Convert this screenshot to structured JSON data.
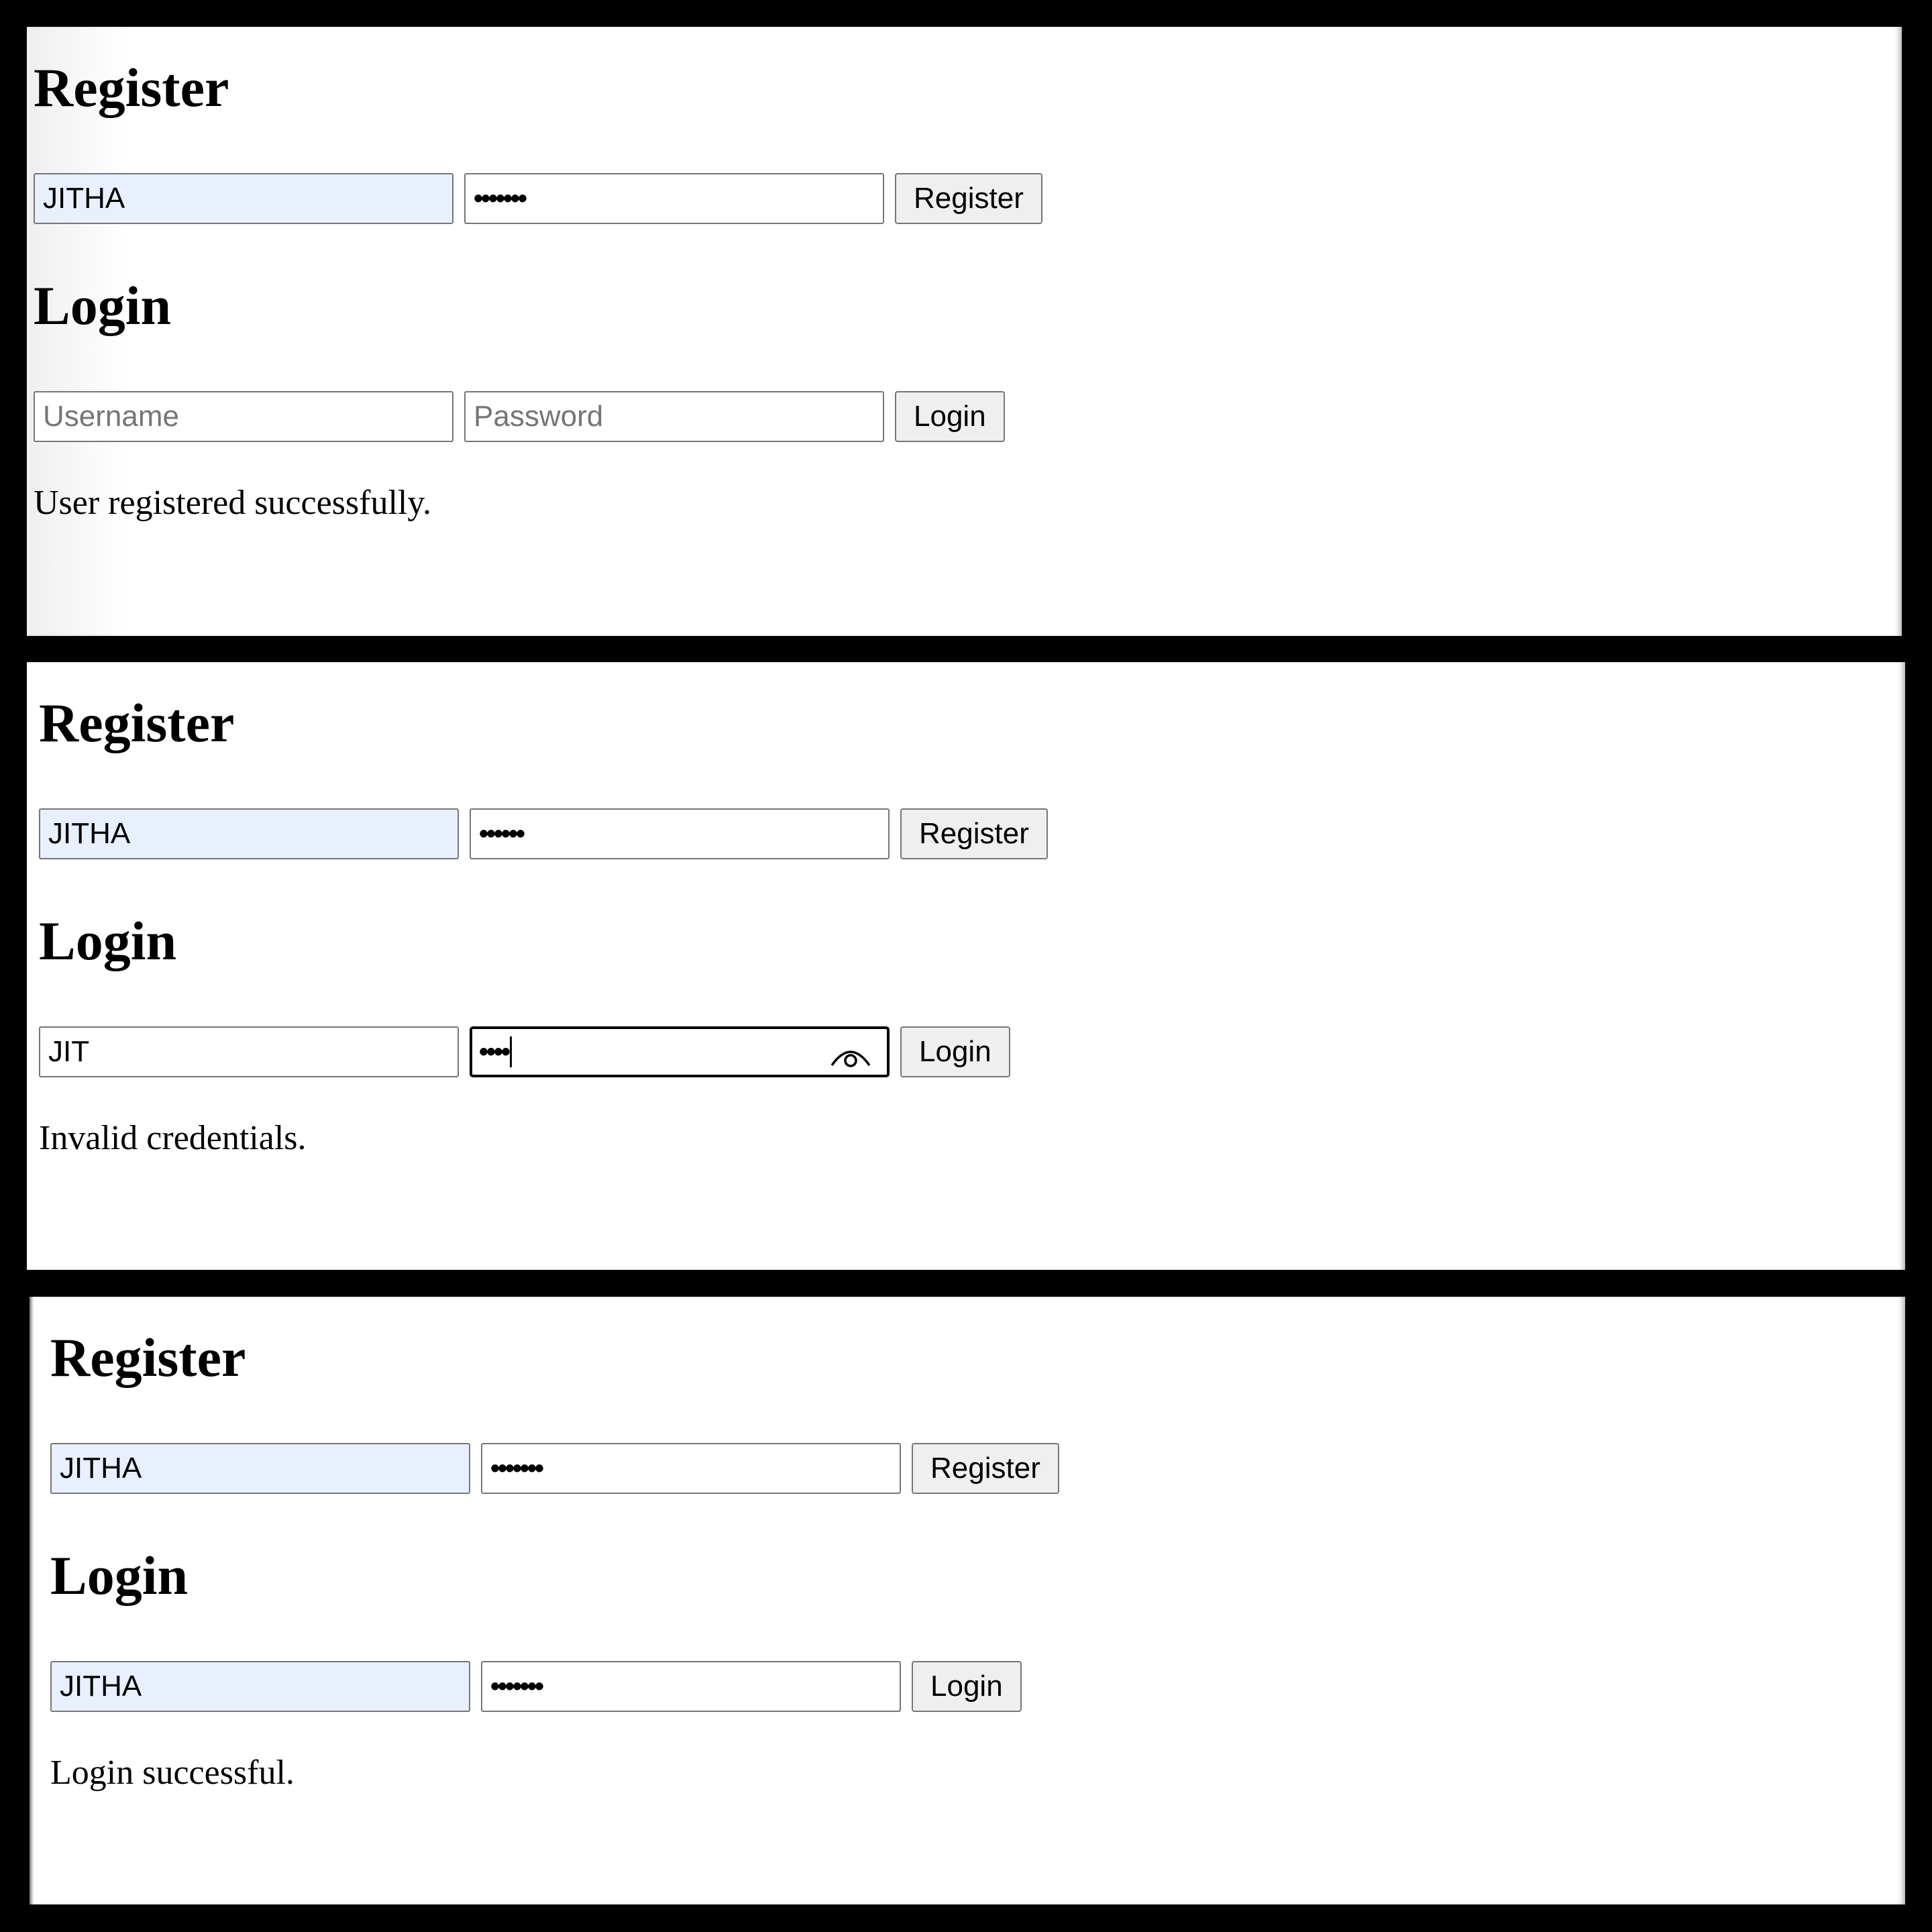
{
  "panels": [
    {
      "register": {
        "heading": "Register",
        "username_value": "JITHA",
        "password_value": "•••••••",
        "button_label": "Register"
      },
      "login": {
        "heading": "Login",
        "username_placeholder": "Username",
        "password_placeholder": "Password",
        "button_label": "Login"
      },
      "message": "User registered successfully."
    },
    {
      "register": {
        "heading": "Register",
        "username_value": "JITHA",
        "password_value": "••••••",
        "button_label": "Register"
      },
      "login": {
        "heading": "Login",
        "username_value": "JIT",
        "password_value": "••••",
        "button_label": "Login",
        "reveal_icon": "eye-icon"
      },
      "message": "Invalid credentials."
    },
    {
      "register": {
        "heading": "Register",
        "username_value": "JITHA",
        "password_value": "•••••••",
        "button_label": "Register"
      },
      "login": {
        "heading": "Login",
        "username_value": "JITHA",
        "password_value": "•••••••",
        "button_label": "Login"
      },
      "message": "Login successful."
    }
  ],
  "colors": {
    "autofill_bg": "#e8f0fe",
    "button_bg": "#efefef",
    "border": "#767676",
    "placeholder": "#757575",
    "background": "#000000"
  }
}
